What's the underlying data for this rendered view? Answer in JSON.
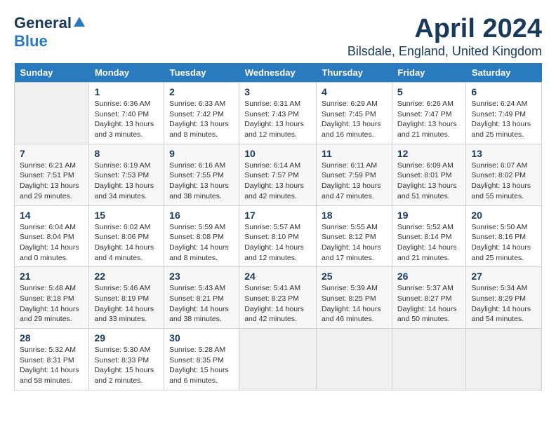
{
  "logo": {
    "general": "General",
    "blue": "Blue"
  },
  "title": "April 2024",
  "location": "Bilsdale, England, United Kingdom",
  "weekdays": [
    "Sunday",
    "Monday",
    "Tuesday",
    "Wednesday",
    "Thursday",
    "Friday",
    "Saturday"
  ],
  "weeks": [
    [
      {
        "num": "",
        "info": ""
      },
      {
        "num": "1",
        "info": "Sunrise: 6:36 AM\nSunset: 7:40 PM\nDaylight: 13 hours\nand 3 minutes."
      },
      {
        "num": "2",
        "info": "Sunrise: 6:33 AM\nSunset: 7:42 PM\nDaylight: 13 hours\nand 8 minutes."
      },
      {
        "num": "3",
        "info": "Sunrise: 6:31 AM\nSunset: 7:43 PM\nDaylight: 13 hours\nand 12 minutes."
      },
      {
        "num": "4",
        "info": "Sunrise: 6:29 AM\nSunset: 7:45 PM\nDaylight: 13 hours\nand 16 minutes."
      },
      {
        "num": "5",
        "info": "Sunrise: 6:26 AM\nSunset: 7:47 PM\nDaylight: 13 hours\nand 21 minutes."
      },
      {
        "num": "6",
        "info": "Sunrise: 6:24 AM\nSunset: 7:49 PM\nDaylight: 13 hours\nand 25 minutes."
      }
    ],
    [
      {
        "num": "7",
        "info": "Sunrise: 6:21 AM\nSunset: 7:51 PM\nDaylight: 13 hours\nand 29 minutes."
      },
      {
        "num": "8",
        "info": "Sunrise: 6:19 AM\nSunset: 7:53 PM\nDaylight: 13 hours\nand 34 minutes."
      },
      {
        "num": "9",
        "info": "Sunrise: 6:16 AM\nSunset: 7:55 PM\nDaylight: 13 hours\nand 38 minutes."
      },
      {
        "num": "10",
        "info": "Sunrise: 6:14 AM\nSunset: 7:57 PM\nDaylight: 13 hours\nand 42 minutes."
      },
      {
        "num": "11",
        "info": "Sunrise: 6:11 AM\nSunset: 7:59 PM\nDaylight: 13 hours\nand 47 minutes."
      },
      {
        "num": "12",
        "info": "Sunrise: 6:09 AM\nSunset: 8:01 PM\nDaylight: 13 hours\nand 51 minutes."
      },
      {
        "num": "13",
        "info": "Sunrise: 6:07 AM\nSunset: 8:02 PM\nDaylight: 13 hours\nand 55 minutes."
      }
    ],
    [
      {
        "num": "14",
        "info": "Sunrise: 6:04 AM\nSunset: 8:04 PM\nDaylight: 14 hours\nand 0 minutes."
      },
      {
        "num": "15",
        "info": "Sunrise: 6:02 AM\nSunset: 8:06 PM\nDaylight: 14 hours\nand 4 minutes."
      },
      {
        "num": "16",
        "info": "Sunrise: 5:59 AM\nSunset: 8:08 PM\nDaylight: 14 hours\nand 8 minutes."
      },
      {
        "num": "17",
        "info": "Sunrise: 5:57 AM\nSunset: 8:10 PM\nDaylight: 14 hours\nand 12 minutes."
      },
      {
        "num": "18",
        "info": "Sunrise: 5:55 AM\nSunset: 8:12 PM\nDaylight: 14 hours\nand 17 minutes."
      },
      {
        "num": "19",
        "info": "Sunrise: 5:52 AM\nSunset: 8:14 PM\nDaylight: 14 hours\nand 21 minutes."
      },
      {
        "num": "20",
        "info": "Sunrise: 5:50 AM\nSunset: 8:16 PM\nDaylight: 14 hours\nand 25 minutes."
      }
    ],
    [
      {
        "num": "21",
        "info": "Sunrise: 5:48 AM\nSunset: 8:18 PM\nDaylight: 14 hours\nand 29 minutes."
      },
      {
        "num": "22",
        "info": "Sunrise: 5:46 AM\nSunset: 8:19 PM\nDaylight: 14 hours\nand 33 minutes."
      },
      {
        "num": "23",
        "info": "Sunrise: 5:43 AM\nSunset: 8:21 PM\nDaylight: 14 hours\nand 38 minutes."
      },
      {
        "num": "24",
        "info": "Sunrise: 5:41 AM\nSunset: 8:23 PM\nDaylight: 14 hours\nand 42 minutes."
      },
      {
        "num": "25",
        "info": "Sunrise: 5:39 AM\nSunset: 8:25 PM\nDaylight: 14 hours\nand 46 minutes."
      },
      {
        "num": "26",
        "info": "Sunrise: 5:37 AM\nSunset: 8:27 PM\nDaylight: 14 hours\nand 50 minutes."
      },
      {
        "num": "27",
        "info": "Sunrise: 5:34 AM\nSunset: 8:29 PM\nDaylight: 14 hours\nand 54 minutes."
      }
    ],
    [
      {
        "num": "28",
        "info": "Sunrise: 5:32 AM\nSunset: 8:31 PM\nDaylight: 14 hours\nand 58 minutes."
      },
      {
        "num": "29",
        "info": "Sunrise: 5:30 AM\nSunset: 8:33 PM\nDaylight: 15 hours\nand 2 minutes."
      },
      {
        "num": "30",
        "info": "Sunrise: 5:28 AM\nSunset: 8:35 PM\nDaylight: 15 hours\nand 6 minutes."
      },
      {
        "num": "",
        "info": ""
      },
      {
        "num": "",
        "info": ""
      },
      {
        "num": "",
        "info": ""
      },
      {
        "num": "",
        "info": ""
      }
    ]
  ]
}
